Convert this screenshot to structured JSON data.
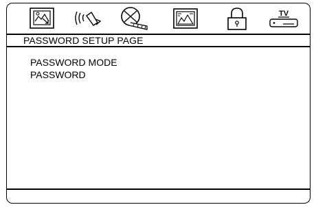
{
  "tabs": [
    {
      "name": "general-setup",
      "icon": "monitor-picture-icon"
    },
    {
      "name": "audio-setup",
      "icon": "speaker-sound-icon"
    },
    {
      "name": "dolby-setup",
      "icon": "film-reel-icon"
    },
    {
      "name": "video-setup",
      "icon": "video-picture-icon"
    },
    {
      "name": "password-setup",
      "icon": "padlock-icon"
    },
    {
      "name": "tv-setup",
      "icon": "tv-icon",
      "label": "TV"
    }
  ],
  "page": {
    "title": "PASSWORD SETUP PAGE",
    "items": [
      "PASSWORD MODE",
      "PASSWORD"
    ]
  }
}
